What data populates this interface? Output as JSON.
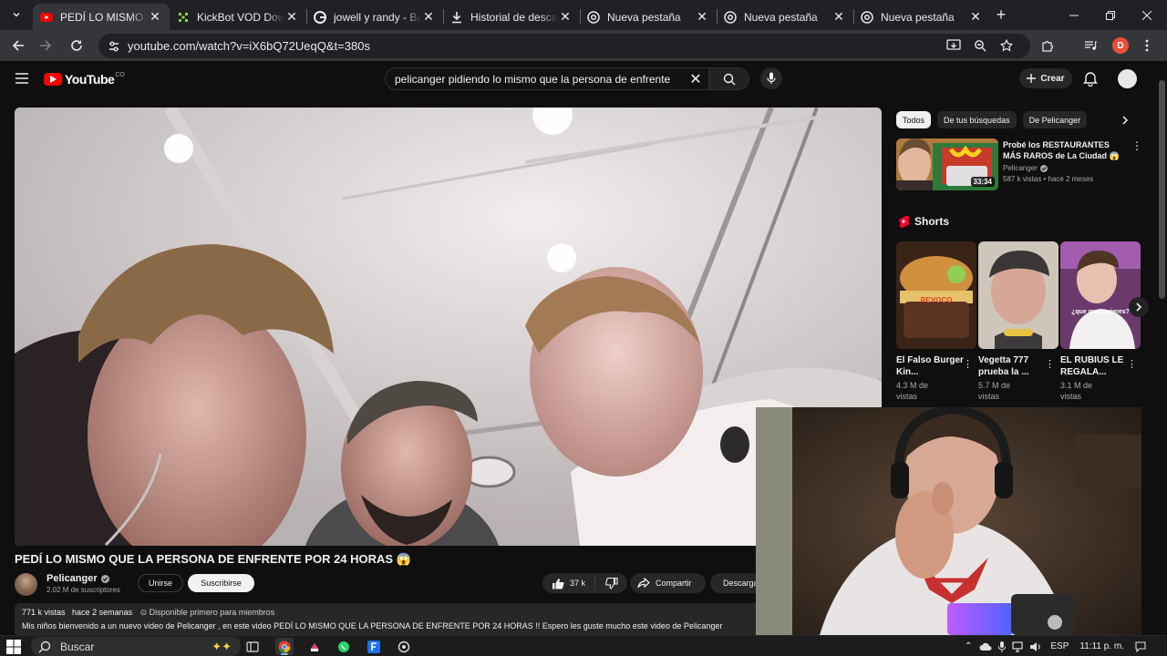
{
  "browser": {
    "tabs": [
      {
        "title": "PEDÍ LO MISMO Q",
        "icon": "youtube-icon",
        "active": true
      },
      {
        "title": "KickBot VOD Dowl",
        "icon": "kickbot-icon",
        "active": false
      },
      {
        "title": "jowell y randy - Bu",
        "icon": "google-icon",
        "active": false
      },
      {
        "title": "Historial de descar",
        "icon": "download-icon",
        "active": false
      },
      {
        "title": "Nueva pestaña",
        "icon": "chrome-icon",
        "active": false
      },
      {
        "title": "Nueva pestaña",
        "icon": "chrome-icon",
        "active": false
      },
      {
        "title": "Nueva pestaña",
        "icon": "chrome-icon",
        "active": false
      }
    ],
    "url": "youtube.com/watch?v=iX6bQ72UeqQ&t=380s",
    "profile_initial": "D"
  },
  "youtube": {
    "logo_text": "YouTube",
    "logo_superscript": "CO",
    "search_query": "pelicanger pidiendo lo mismo que la persona de enfrente",
    "create_label": "Crear"
  },
  "video": {
    "title": "PEDÍ LO MISMO QUE LA PERSONA DE ENFRENTE POR 24 HORAS 😱",
    "channel": "Pelicanger",
    "subscribers": "2.02 M de suscriptores",
    "join_label": "Unirse",
    "subscribe_label": "Suscribirse",
    "likes": "37 k",
    "share_label": "Compartir",
    "download_label": "Descargar",
    "views": "771 k vistas",
    "age": "hace 2 semanas",
    "members_label": "Disponible primero para miembros",
    "description": "Mis niños bienvenido a un nuevo video de Pelicanger , en este video PEDÍ LO MISMO QUE LA PERSONA DE ENFRENTE POR 24 HORAS !! Espero les guste mucho este video de Pelicanger"
  },
  "sidebar": {
    "chips": [
      "Todos",
      "De tus búsquedas",
      "De Pelicanger"
    ],
    "recommended": {
      "title": "Probé los RESTAURANTES MÁS RAROS de La Ciudad 😱",
      "channel": "Pelicanger",
      "views": "587 k vistas",
      "age": "hace 2 meses",
      "duration": "33:34"
    },
    "shorts_label": "Shorts",
    "shorts": [
      {
        "title": "El Falso Burger Kin...",
        "views": "4.3 M de vistas",
        "thumb_text": "REVOCO"
      },
      {
        "title": "Vegetta 777 prueba la ...",
        "views": "5.7 M de vistas",
        "thumb_text": ""
      },
      {
        "title": "EL RUBIUS LE REGALA...",
        "views": "3.1 M de vistas",
        "thumb_text": "¿que mas quieres?"
      }
    ]
  },
  "taskbar": {
    "search_placeholder": "Buscar",
    "language": "ESP",
    "time": "11:11 p. m."
  }
}
